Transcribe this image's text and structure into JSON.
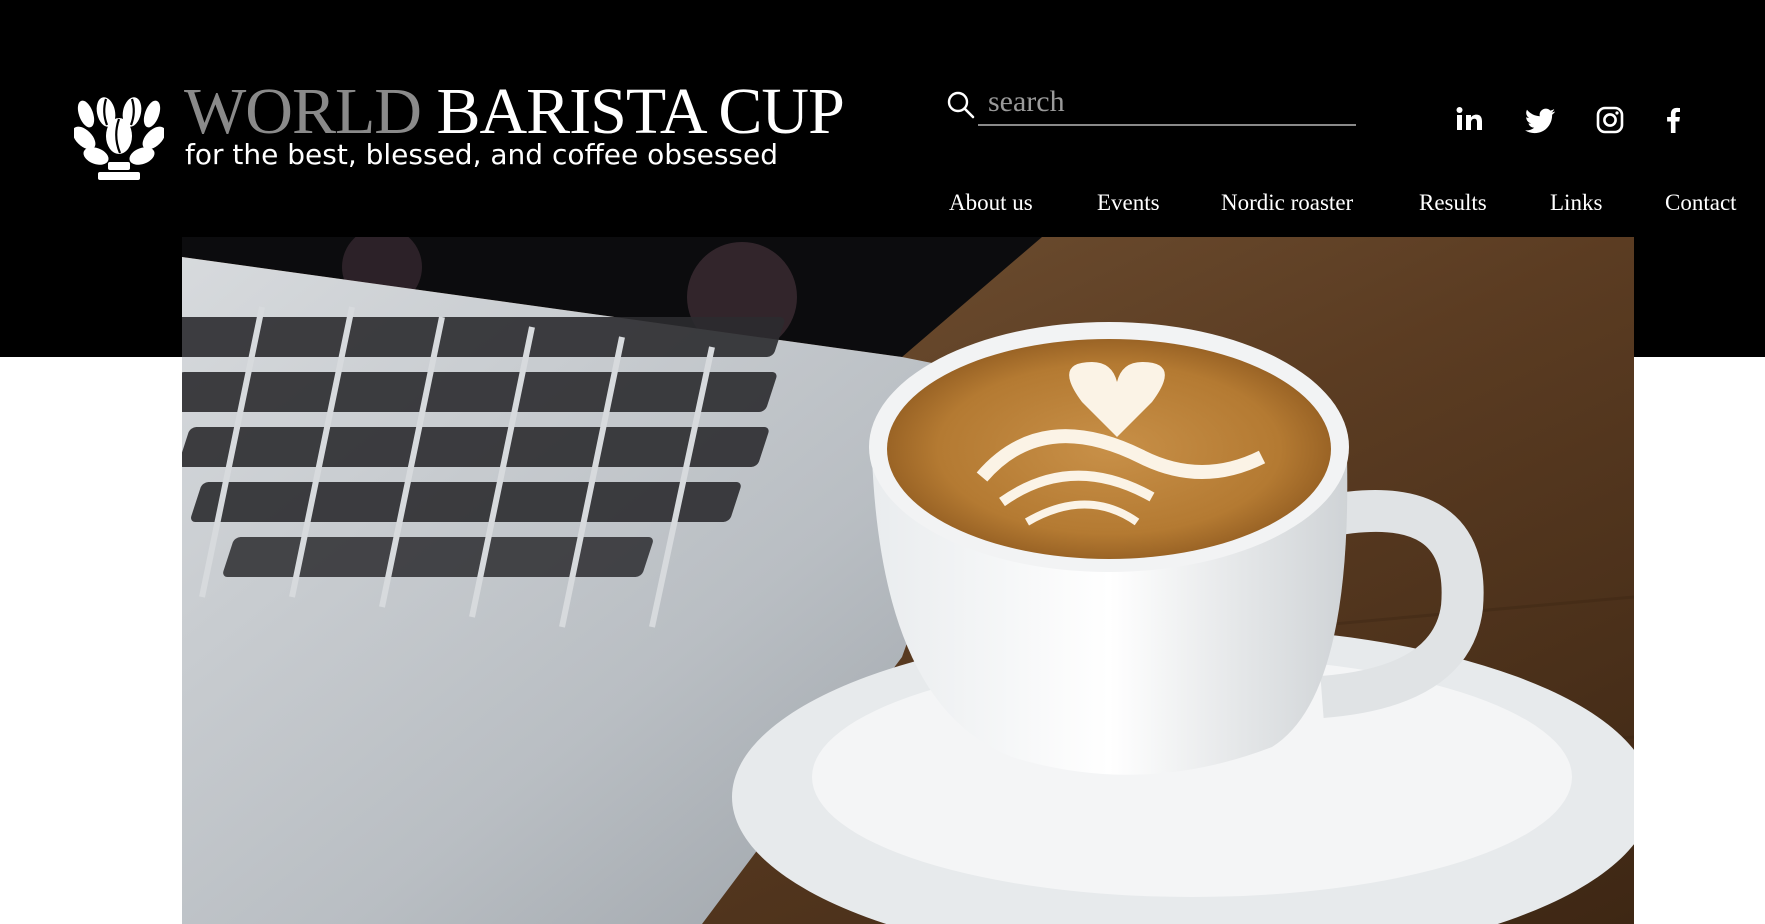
{
  "brand": {
    "title_part1": "WORLD",
    "title_part2": "BARISTA CUP",
    "tagline": "for the best, blessed, and coffee obsessed",
    "colors": {
      "header_bg": "#000000",
      "title_muted": "#8a8a8a",
      "text": "#ffffff"
    }
  },
  "search": {
    "placeholder": "search",
    "value": ""
  },
  "social": [
    {
      "name": "linkedin-icon"
    },
    {
      "name": "twitter-icon"
    },
    {
      "name": "instagram-icon"
    },
    {
      "name": "facebook-icon"
    }
  ],
  "nav": {
    "items": [
      {
        "label": "About us"
      },
      {
        "label": "Events"
      },
      {
        "label": "Nordic roaster"
      },
      {
        "label": "Results"
      },
      {
        "label": "Links"
      },
      {
        "label": "Contact"
      }
    ]
  },
  "hero": {
    "image": "latte-art-coffee-cup-beside-laptop"
  }
}
